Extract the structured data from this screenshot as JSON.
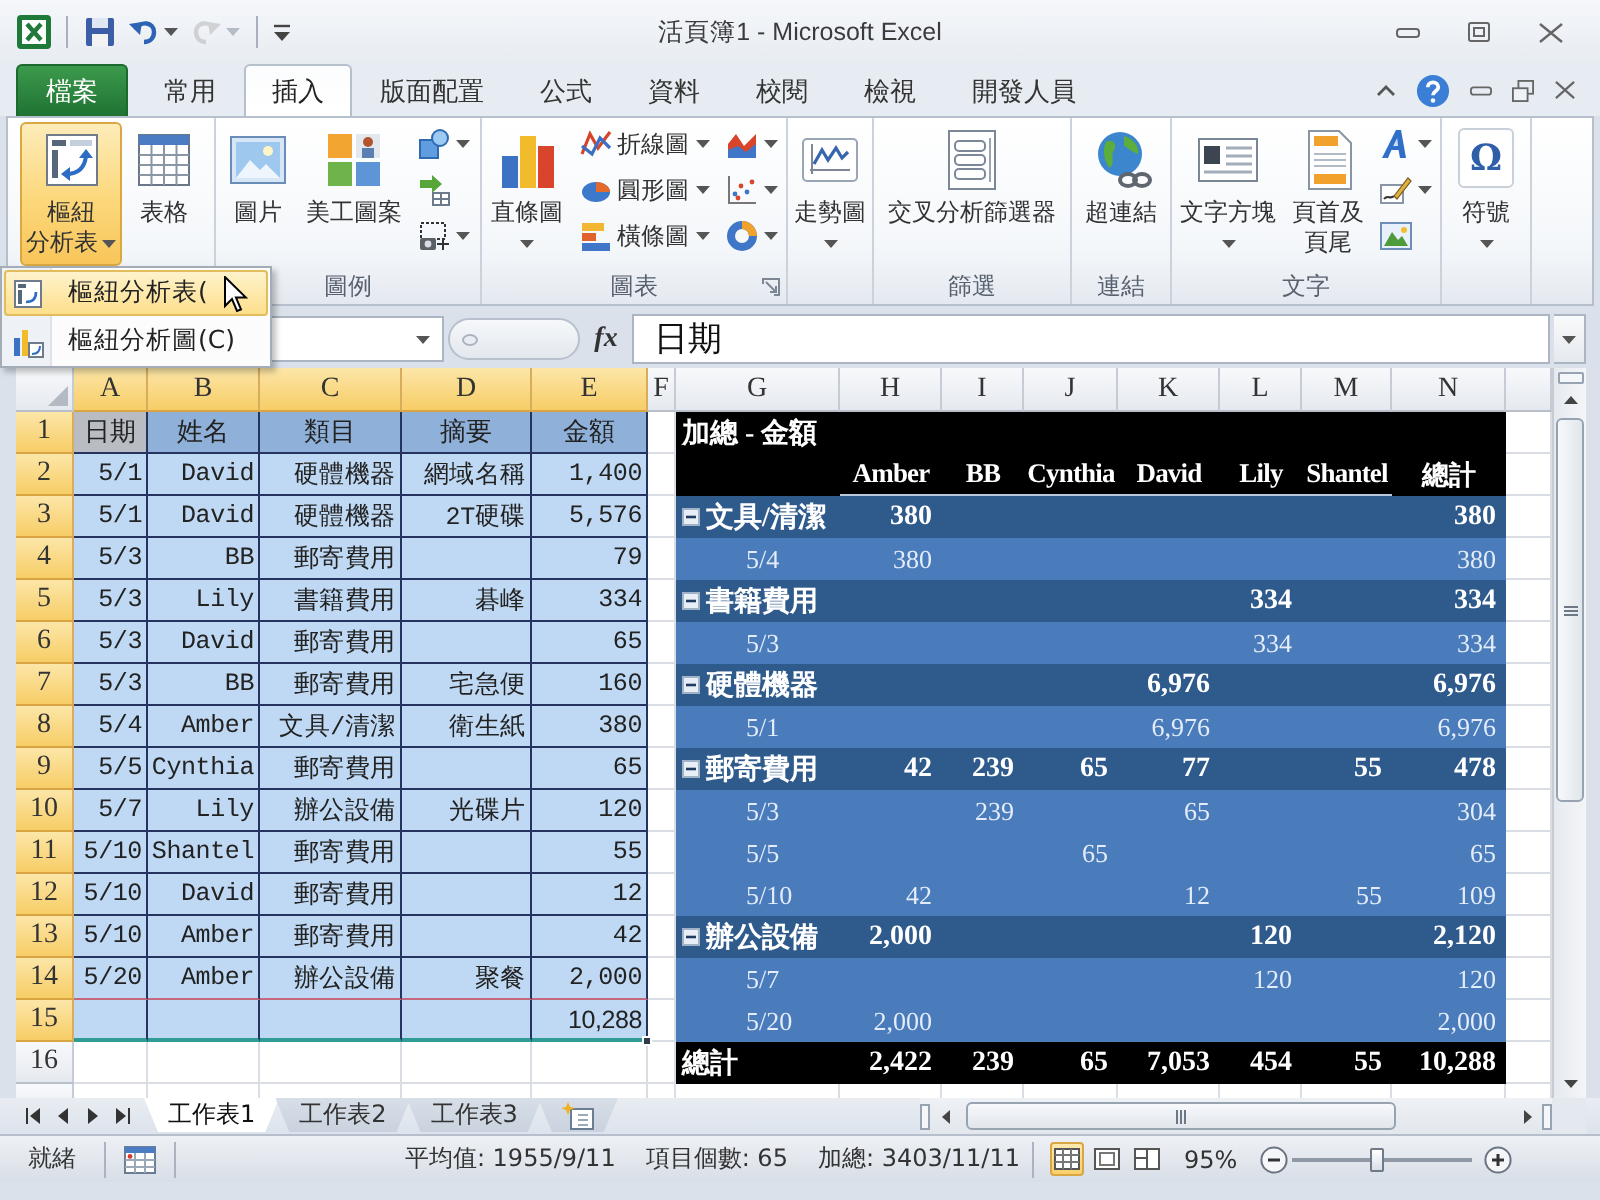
{
  "window": {
    "title": "活頁簿1 - Microsoft Excel"
  },
  "quick_access": [
    {
      "kind": "save",
      "disabled": false
    },
    {
      "kind": "undo",
      "disabled": false
    },
    {
      "kind": "redo",
      "disabled": true
    }
  ],
  "ribbon_tabs": [
    {
      "label": "檔案",
      "kind": "file",
      "selected": false
    },
    {
      "label": "常用",
      "kind": "tab",
      "selected": false
    },
    {
      "label": "插入",
      "kind": "tab",
      "selected": true
    },
    {
      "label": "版面配置",
      "kind": "tab",
      "selected": false
    },
    {
      "label": "公式",
      "kind": "tab",
      "selected": false
    },
    {
      "label": "資料",
      "kind": "tab",
      "selected": false
    },
    {
      "label": "校閱",
      "kind": "tab",
      "selected": false
    },
    {
      "label": "檢視",
      "kind": "tab",
      "selected": false
    },
    {
      "label": "開發人員",
      "kind": "tab",
      "selected": false
    }
  ],
  "ribbon": {
    "groups": [
      {
        "items": [
          {
            "kind": "large",
            "label_lines": [
              "樞紐",
              "分析表"
            ],
            "dropdown": true,
            "pressed": true
          },
          {
            "kind": "large",
            "label_lines": [
              "表格"
            ],
            "dropdown": false,
            "pressed": false
          }
        ]
      },
      {
        "label": "圖例",
        "items": [
          {
            "kind": "large",
            "label_lines": [
              "圖片"
            ],
            "dropdown": false,
            "pressed": false
          },
          {
            "kind": "large",
            "label_lines": [
              "美工圖案"
            ],
            "dropdown": false,
            "pressed": false
          },
          {
            "kind": "icon",
            "dropdown": true,
            "pressed": false
          },
          {
            "kind": "icon",
            "dropdown": false,
            "pressed": false
          },
          {
            "kind": "icon",
            "dropdown": true,
            "pressed": false
          }
        ]
      },
      {
        "label": "圖表",
        "launcher": true,
        "items": [
          {
            "kind": "large",
            "label_lines": [
              "直條圖"
            ],
            "dropdown": true,
            "pressed": false
          },
          {
            "kind": "small",
            "label": "折線圖",
            "dropdown": true,
            "pressed": false
          },
          {
            "kind": "small",
            "label": "圓形圖",
            "dropdown": true,
            "pressed": false
          },
          {
            "kind": "small",
            "label": "橫條圖",
            "dropdown": true,
            "pressed": false
          },
          {
            "kind": "icon",
            "dropdown": true,
            "pressed": false
          },
          {
            "kind": "icon",
            "dropdown": true,
            "pressed": false
          },
          {
            "kind": "icon",
            "dropdown": true,
            "pressed": false
          }
        ]
      },
      {
        "items": [
          {
            "kind": "large",
            "label_lines": [
              "走勢圖"
            ],
            "dropdown": true,
            "pressed": false
          }
        ]
      },
      {
        "label": "篩選",
        "items": [
          {
            "kind": "large",
            "label_lines": [
              "交叉分析篩選器"
            ],
            "dropdown": false,
            "pressed": false
          }
        ]
      },
      {
        "label": "連結",
        "items": [
          {
            "kind": "large",
            "label_lines": [
              "超連結"
            ],
            "dropdown": false,
            "pressed": false
          }
        ]
      },
      {
        "label": "文字",
        "items": [
          {
            "kind": "large",
            "label_lines": [
              "文字方塊"
            ],
            "dropdown": true,
            "pressed": false
          },
          {
            "kind": "large",
            "label_lines": [
              "頁首及",
              "頁尾"
            ],
            "dropdown": false,
            "pressed": false
          },
          {
            "kind": "icon",
            "dropdown": true,
            "pressed": false
          },
          {
            "kind": "icon",
            "dropdown": true,
            "pressed": false
          },
          {
            "kind": "icon",
            "dropdown": false,
            "pressed": false
          }
        ]
      },
      {
        "items": [
          {
            "kind": "large",
            "glyph": "Ω",
            "label_lines": [
              "符號"
            ],
            "dropdown": true,
            "pressed": false
          }
        ]
      }
    ]
  },
  "pivot_menu": {
    "items": [
      {
        "label": "樞紐分析表(",
        "selected": true
      },
      {
        "label": "樞紐分析圖(C)",
        "selected": false
      }
    ]
  },
  "formula_bar": {
    "function_label": "fx",
    "value": "日期"
  },
  "sheet": {
    "column_headers": [
      {
        "label": "A",
        "selected": true
      },
      {
        "label": "B",
        "selected": true
      },
      {
        "label": "C",
        "selected": true
      },
      {
        "label": "D",
        "selected": true
      },
      {
        "label": "E",
        "selected": true
      },
      {
        "label": "F",
        "selected": false
      },
      {
        "label": "G",
        "selected": false
      },
      {
        "label": "H",
        "selected": false
      },
      {
        "label": "I",
        "selected": false
      },
      {
        "label": "J",
        "selected": false
      },
      {
        "label": "K",
        "selected": false
      },
      {
        "label": "L",
        "selected": false
      },
      {
        "label": "M",
        "selected": false
      },
      {
        "label": "N",
        "selected": false
      }
    ],
    "row_headers": [
      {
        "label": "1",
        "selected": true
      },
      {
        "label": "2",
        "selected": true
      },
      {
        "label": "3",
        "selected": true
      },
      {
        "label": "4",
        "selected": true
      },
      {
        "label": "5",
        "selected": true
      },
      {
        "label": "6",
        "selected": true
      },
      {
        "label": "7",
        "selected": true
      },
      {
        "label": "8",
        "selected": true
      },
      {
        "label": "9",
        "selected": true
      },
      {
        "label": "10",
        "selected": true
      },
      {
        "label": "11",
        "selected": true
      },
      {
        "label": "12",
        "selected": true
      },
      {
        "label": "13",
        "selected": true
      },
      {
        "label": "14",
        "selected": true
      },
      {
        "label": "15",
        "selected": true
      },
      {
        "label": "16",
        "selected": false
      }
    ],
    "source_table": {
      "header": [
        {
          "label": "日期",
          "active": true
        },
        {
          "label": "姓名",
          "active": false
        },
        {
          "label": "類目",
          "active": false
        },
        {
          "label": "摘要",
          "active": false
        },
        {
          "label": "金額",
          "active": false
        }
      ],
      "rows": [
        {
          "date": "5/1",
          "name": "David",
          "category": "硬體機器",
          "summary": "網域名稱",
          "amount": "1,400"
        },
        {
          "date": "5/1",
          "name": "David",
          "category": "硬體機器",
          "summary": "2T硬碟",
          "amount": "5,576"
        },
        {
          "date": "5/3",
          "name": "BB",
          "category": "郵寄費用",
          "amount": "79"
        },
        {
          "date": "5/3",
          "name": "Lily",
          "category": "書籍費用",
          "summary": "碁峰",
          "amount": "334"
        },
        {
          "date": "5/3",
          "name": "David",
          "category": "郵寄費用",
          "amount": "65"
        },
        {
          "date": "5/3",
          "name": "BB",
          "category": "郵寄費用",
          "summary": "宅急便",
          "amount": "160"
        },
        {
          "date": "5/4",
          "name": "Amber",
          "category": "文具/清潔",
          "summary": "衛生紙",
          "amount": "380"
        },
        {
          "date": "5/5",
          "name": "Cynthia",
          "category": "郵寄費用",
          "amount": "65"
        },
        {
          "date": "5/7",
          "name": "Lily",
          "category": "辦公設備",
          "summary": "光碟片",
          "amount": "120"
        },
        {
          "date": "5/10",
          "name": "Shantel",
          "category": "郵寄費用",
          "amount": "55"
        },
        {
          "date": "5/10",
          "name": "David",
          "category": "郵寄費用",
          "amount": "12"
        },
        {
          "date": "5/10",
          "name": "Amber",
          "category": "郵寄費用",
          "amount": "42"
        },
        {
          "date": "5/20",
          "name": "Amber",
          "category": "辦公設備",
          "summary": "聚餐",
          "amount": "2,000"
        }
      ],
      "total": "10,288"
    },
    "pivot_table": {
      "title": "加總 - 金額",
      "columns": [
        "Amber",
        "BB",
        "Cynthia",
        "David",
        "Lily",
        "Shantel",
        "總計"
      ],
      "groups": [
        {
          "label": "文具/清潔",
          "expanded": true,
          "cells": [
            {
              "kind": "amount",
              "text": "380"
            },
            {
              "kind": "blank"
            },
            {
              "kind": "blank"
            },
            {
              "kind": "blank"
            },
            {
              "kind": "blank"
            },
            {
              "kind": "blank"
            },
            {
              "kind": "amount",
              "text": "380"
            }
          ],
          "children": [
            {
              "label": "5/4",
              "cells": [
                {
                  "kind": "amount",
                  "text": "380"
                },
                {
                  "kind": "blank"
                },
                {
                  "kind": "blank"
                },
                {
                  "kind": "blank"
                },
                {
                  "kind": "blank"
                },
                {
                  "kind": "blank"
                },
                {
                  "kind": "amount",
                  "text": "380"
                }
              ]
            }
          ]
        },
        {
          "label": "書籍費用",
          "expanded": true,
          "cells": [
            {
              "kind": "blank"
            },
            {
              "kind": "blank"
            },
            {
              "kind": "blank"
            },
            {
              "kind": "blank"
            },
            {
              "kind": "amount",
              "text": "334"
            },
            {
              "kind": "blank"
            },
            {
              "kind": "amount",
              "text": "334"
            }
          ],
          "children": [
            {
              "label": "5/3",
              "cells": [
                {
                  "kind": "blank"
                },
                {
                  "kind": "blank"
                },
                {
                  "kind": "blank"
                },
                {
                  "kind": "blank"
                },
                {
                  "kind": "amount",
                  "text": "334"
                },
                {
                  "kind": "blank"
                },
                {
                  "kind": "amount",
                  "text": "334"
                }
              ]
            }
          ]
        },
        {
          "label": "硬體機器",
          "expanded": true,
          "cells": [
            {
              "kind": "blank"
            },
            {
              "kind": "blank"
            },
            {
              "kind": "blank"
            },
            {
              "kind": "amount",
              "text": "6,976"
            },
            {
              "kind": "blank"
            },
            {
              "kind": "blank"
            },
            {
              "kind": "amount",
              "text": "6,976"
            }
          ],
          "children": [
            {
              "label": "5/1",
              "cells": [
                {
                  "kind": "blank"
                },
                {
                  "kind": "blank"
                },
                {
                  "kind": "blank"
                },
                {
                  "kind": "amount",
                  "text": "6,976"
                },
                {
                  "kind": "blank"
                },
                {
                  "kind": "blank"
                },
                {
                  "kind": "amount",
                  "text": "6,976"
                }
              ]
            }
          ]
        },
        {
          "label": "郵寄費用",
          "expanded": true,
          "cells": [
            {
              "kind": "amount",
              "text": "42"
            },
            {
              "kind": "amount",
              "text": "239"
            },
            {
              "kind": "amount",
              "text": "65"
            },
            {
              "kind": "amount",
              "text": "77"
            },
            {
              "kind": "blank"
            },
            {
              "kind": "amount",
              "text": "55"
            },
            {
              "kind": "amount",
              "text": "478"
            }
          ],
          "children": [
            {
              "label": "5/3",
              "cells": [
                {
                  "kind": "blank"
                },
                {
                  "kind": "amount",
                  "text": "239"
                },
                {
                  "kind": "blank"
                },
                {
                  "kind": "amount",
                  "text": "65"
                },
                {
                  "kind": "blank"
                },
                {
                  "kind": "blank"
                },
                {
                  "kind": "amount",
                  "text": "304"
                }
              ]
            },
            {
              "label": "5/5",
              "cells": [
                {
                  "kind": "blank"
                },
                {
                  "kind": "blank"
                },
                {
                  "kind": "amount",
                  "text": "65"
                },
                {
                  "kind": "blank"
                },
                {
                  "kind": "blank"
                },
                {
                  "kind": "blank"
                },
                {
                  "kind": "amount",
                  "text": "65"
                }
              ]
            },
            {
              "label": "5/10",
              "cells": [
                {
                  "kind": "amount",
                  "text": "42"
                },
                {
                  "kind": "blank"
                },
                {
                  "kind": "blank"
                },
                {
                  "kind": "amount",
                  "text": "12"
                },
                {
                  "kind": "blank"
                },
                {
                  "kind": "amount",
                  "text": "55"
                },
                {
                  "kind": "amount",
                  "text": "109"
                }
              ]
            }
          ]
        },
        {
          "label": "辦公設備",
          "expanded": true,
          "cells": [
            {
              "kind": "amount",
              "text": "2,000"
            },
            {
              "kind": "blank"
            },
            {
              "kind": "blank"
            },
            {
              "kind": "blank"
            },
            {
              "kind": "amount",
              "text": "120"
            },
            {
              "kind": "blank"
            },
            {
              "kind": "amount",
              "text": "2,120"
            }
          ],
          "children": [
            {
              "label": "5/7",
              "cells": [
                {
                  "kind": "blank"
                },
                {
                  "kind": "blank"
                },
                {
                  "kind": "blank"
                },
                {
                  "kind": "blank"
                },
                {
                  "kind": "amount",
                  "text": "120"
                },
                {
                  "kind": "blank"
                },
                {
                  "kind": "amount",
                  "text": "120"
                }
              ]
            },
            {
              "label": "5/20",
              "cells": [
                {
                  "kind": "amount",
                  "text": "2,000"
                },
                {
                  "kind": "blank"
                },
                {
                  "kind": "blank"
                },
                {
                  "kind": "blank"
                },
                {
                  "kind": "blank"
                },
                {
                  "kind": "blank"
                },
                {
                  "kind": "amount",
                  "text": "2,000"
                }
              ]
            }
          ]
        }
      ],
      "total_label": "總計",
      "totals": [
        "2,422",
        "239",
        "65",
        "7,053",
        "454",
        "55",
        "10,288"
      ]
    }
  },
  "sheet_tabs": [
    {
      "label": "工作表1",
      "selected": true
    },
    {
      "label": "工作表2",
      "selected": false
    },
    {
      "label": "工作表3",
      "selected": false
    }
  ],
  "status_bar": {
    "mode": "就緒",
    "stats": [
      "平均值: 1955/9/11",
      "項目個數: 65",
      "加總: 3403/11/11"
    ],
    "views": [
      {
        "kind": "normal",
        "selected": true
      },
      {
        "kind": "page_layout",
        "selected": false
      },
      {
        "kind": "page_break",
        "selected": false
      }
    ],
    "zoom": {
      "label": "95%",
      "level": 0.47
    }
  }
}
